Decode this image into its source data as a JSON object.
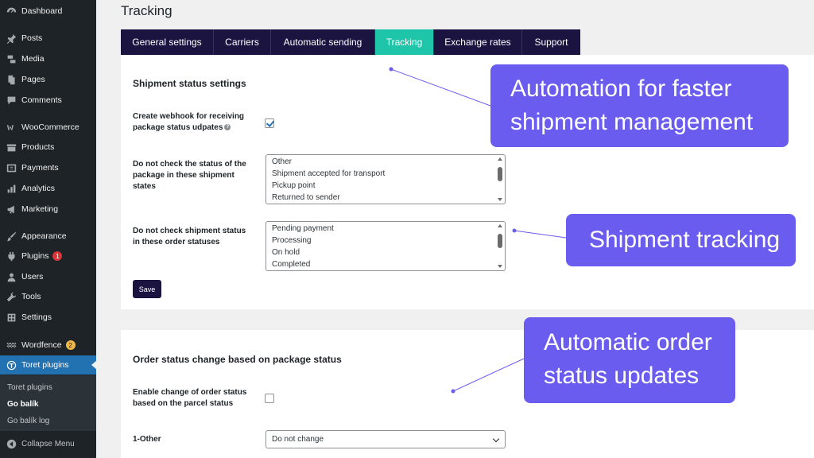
{
  "sidebar": {
    "items": [
      {
        "label": "Dashboard",
        "icon": "dashboard-icon"
      },
      {
        "label": "Posts",
        "icon": "pin-icon"
      },
      {
        "label": "Media",
        "icon": "media-icon"
      },
      {
        "label": "Pages",
        "icon": "pages-icon"
      },
      {
        "label": "Comments",
        "icon": "comments-icon"
      },
      {
        "label": "WooCommerce",
        "icon": "woocommerce-icon"
      },
      {
        "label": "Products",
        "icon": "products-icon"
      },
      {
        "label": "Payments",
        "icon": "payments-icon"
      },
      {
        "label": "Analytics",
        "icon": "analytics-icon"
      },
      {
        "label": "Marketing",
        "icon": "megaphone-icon"
      },
      {
        "label": "Appearance",
        "icon": "brush-icon"
      },
      {
        "label": "Plugins",
        "icon": "plug-icon",
        "badge": "1"
      },
      {
        "label": "Users",
        "icon": "user-icon"
      },
      {
        "label": "Tools",
        "icon": "wrench-icon"
      },
      {
        "label": "Settings",
        "icon": "settings-icon"
      },
      {
        "label": "Wordfence",
        "icon": "wordfence-icon",
        "badge": "2"
      },
      {
        "label": "Toret plugins",
        "icon": "toret-icon"
      }
    ],
    "submenu": [
      "Toret plugins",
      "Go balík",
      "Go balík log"
    ],
    "collapse_label": "Collapse Menu"
  },
  "page": {
    "title": "Tracking"
  },
  "tabs": [
    "General settings",
    "Carriers",
    "Automatic sending",
    "Tracking",
    "Exchange rates",
    "Support"
  ],
  "shipment_settings": {
    "title": "Shipment status settings",
    "webhook_label": "Create webhook for receiving package status udpates",
    "webhook_checked": true,
    "exclude_states_label": "Do not check the status of the package in these shipment states",
    "exclude_states_options": [
      "Other",
      "Shipment accepted for transport",
      "Pickup point",
      "Returned to sender"
    ],
    "exclude_order_label": "Do not check shipment status in these order statuses",
    "exclude_order_options": [
      "Pending payment",
      "Processing",
      "On hold",
      "Completed"
    ],
    "save_label": "Save"
  },
  "order_status": {
    "title": "Order status change based on package status",
    "enable_label": "Enable change of order status based on the parcel status",
    "enable_checked": false,
    "row_label": "1-Other",
    "row_value": "Do not change"
  },
  "callouts": {
    "automation": [
      "Automation for faster",
      "shipment management"
    ],
    "tracking": "Shipment tracking",
    "order_updates": [
      "Automatic order",
      "status updates"
    ]
  },
  "colors": {
    "sidebar_bg": "#1d2327",
    "active_menu": "#2271b1",
    "tab_bar": "#1b1440",
    "tab_active": "#1ec5a8",
    "callout": "#6b5cf0"
  }
}
